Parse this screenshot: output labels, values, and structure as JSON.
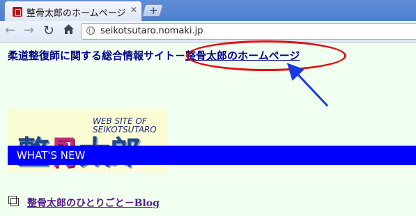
{
  "browser": {
    "tab": {
      "title": "整骨太郎のホームページ",
      "close_icon": "close-icon"
    },
    "new_tab_label": "+",
    "toolbar": {
      "back_icon": "back-arrow-icon",
      "forward_icon": "forward-arrow-icon",
      "reload_icon": "reload-icon",
      "home_icon": "home-icon"
    },
    "address": {
      "url": "seikotsutaro.nomaki.jp"
    }
  },
  "page": {
    "heading_prefix": "柔道整復師に関する総合情報サイト－",
    "heading_link": "整骨太郎のホームページ",
    "logo": {
      "tagline_line1": "WEB SITE OF",
      "tagline_line2": "SEIKOTSUTARO",
      "char1": "整",
      "char2": "骨",
      "char3": "太郎"
    },
    "news_bar_title": "WHAT'S NEW",
    "blog_link": "整骨太郎のひとりごと－Blog"
  },
  "annotation": {
    "ring_color": "#e01010",
    "arrow_color": "#1a3ae0"
  },
  "colors": {
    "link": "#00008b",
    "visited": "#551a8b",
    "news_bar": "#0000ff",
    "page_bg": "#f0fff0"
  }
}
